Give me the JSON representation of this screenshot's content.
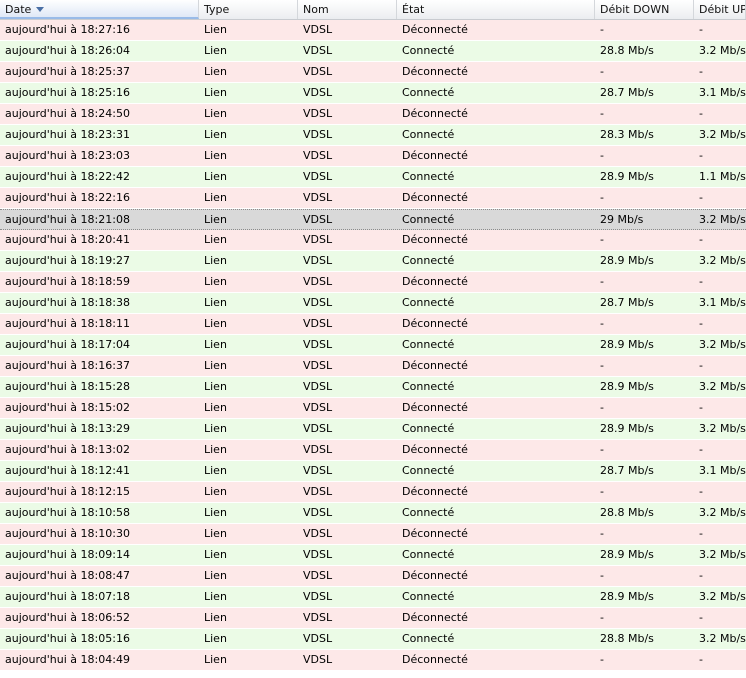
{
  "columns": {
    "date": "Date",
    "type": "Type",
    "nom": "Nom",
    "etat": "État",
    "debit_down": "Débit DOWN",
    "debit_up": "Débit UP"
  },
  "sort": {
    "column": "date",
    "direction": "descending"
  },
  "colors": {
    "disconnected_row": "#fde8e8",
    "connected_row": "#ebfbe6",
    "selected_row": "#d9d9d9",
    "header_sorted_accent": "#99bbe8"
  },
  "selected_index": 9,
  "rows": [
    {
      "date": "aujourd'hui à 18:27:16",
      "type": "Lien",
      "nom": "VDSL",
      "etat": "Déconnecté",
      "down": "-",
      "up": "-"
    },
    {
      "date": "aujourd'hui à 18:26:04",
      "type": "Lien",
      "nom": "VDSL",
      "etat": "Connecté",
      "down": "28.8 Mb/s",
      "up": "3.2 Mb/s"
    },
    {
      "date": "aujourd'hui à 18:25:37",
      "type": "Lien",
      "nom": "VDSL",
      "etat": "Déconnecté",
      "down": "-",
      "up": "-"
    },
    {
      "date": "aujourd'hui à 18:25:16",
      "type": "Lien",
      "nom": "VDSL",
      "etat": "Connecté",
      "down": "28.7 Mb/s",
      "up": "3.1 Mb/s"
    },
    {
      "date": "aujourd'hui à 18:24:50",
      "type": "Lien",
      "nom": "VDSL",
      "etat": "Déconnecté",
      "down": "-",
      "up": "-"
    },
    {
      "date": "aujourd'hui à 18:23:31",
      "type": "Lien",
      "nom": "VDSL",
      "etat": "Connecté",
      "down": "28.3 Mb/s",
      "up": "3.2 Mb/s"
    },
    {
      "date": "aujourd'hui à 18:23:03",
      "type": "Lien",
      "nom": "VDSL",
      "etat": "Déconnecté",
      "down": "-",
      "up": "-"
    },
    {
      "date": "aujourd'hui à 18:22:42",
      "type": "Lien",
      "nom": "VDSL",
      "etat": "Connecté",
      "down": "28.9 Mb/s",
      "up": "1.1 Mb/s"
    },
    {
      "date": "aujourd'hui à 18:22:16",
      "type": "Lien",
      "nom": "VDSL",
      "etat": "Déconnecté",
      "down": "-",
      "up": "-"
    },
    {
      "date": "aujourd'hui à 18:21:08",
      "type": "Lien",
      "nom": "VDSL",
      "etat": "Connecté",
      "down": "29 Mb/s",
      "up": "3.2 Mb/s"
    },
    {
      "date": "aujourd'hui à 18:20:41",
      "type": "Lien",
      "nom": "VDSL",
      "etat": "Déconnecté",
      "down": "-",
      "up": "-"
    },
    {
      "date": "aujourd'hui à 18:19:27",
      "type": "Lien",
      "nom": "VDSL",
      "etat": "Connecté",
      "down": "28.9 Mb/s",
      "up": "3.2 Mb/s"
    },
    {
      "date": "aujourd'hui à 18:18:59",
      "type": "Lien",
      "nom": "VDSL",
      "etat": "Déconnecté",
      "down": "-",
      "up": "-"
    },
    {
      "date": "aujourd'hui à 18:18:38",
      "type": "Lien",
      "nom": "VDSL",
      "etat": "Connecté",
      "down": "28.7 Mb/s",
      "up": "3.1 Mb/s"
    },
    {
      "date": "aujourd'hui à 18:18:11",
      "type": "Lien",
      "nom": "VDSL",
      "etat": "Déconnecté",
      "down": "-",
      "up": "-"
    },
    {
      "date": "aujourd'hui à 18:17:04",
      "type": "Lien",
      "nom": "VDSL",
      "etat": "Connecté",
      "down": "28.9 Mb/s",
      "up": "3.2 Mb/s"
    },
    {
      "date": "aujourd'hui à 18:16:37",
      "type": "Lien",
      "nom": "VDSL",
      "etat": "Déconnecté",
      "down": "-",
      "up": "-"
    },
    {
      "date": "aujourd'hui à 18:15:28",
      "type": "Lien",
      "nom": "VDSL",
      "etat": "Connecté",
      "down": "28.9 Mb/s",
      "up": "3.2 Mb/s"
    },
    {
      "date": "aujourd'hui à 18:15:02",
      "type": "Lien",
      "nom": "VDSL",
      "etat": "Déconnecté",
      "down": "-",
      "up": "-"
    },
    {
      "date": "aujourd'hui à 18:13:29",
      "type": "Lien",
      "nom": "VDSL",
      "etat": "Connecté",
      "down": "28.9 Mb/s",
      "up": "3.2 Mb/s"
    },
    {
      "date": "aujourd'hui à 18:13:02",
      "type": "Lien",
      "nom": "VDSL",
      "etat": "Déconnecté",
      "down": "-",
      "up": "-"
    },
    {
      "date": "aujourd'hui à 18:12:41",
      "type": "Lien",
      "nom": "VDSL",
      "etat": "Connecté",
      "down": "28.7 Mb/s",
      "up": "3.1 Mb/s"
    },
    {
      "date": "aujourd'hui à 18:12:15",
      "type": "Lien",
      "nom": "VDSL",
      "etat": "Déconnecté",
      "down": "-",
      "up": "-"
    },
    {
      "date": "aujourd'hui à 18:10:58",
      "type": "Lien",
      "nom": "VDSL",
      "etat": "Connecté",
      "down": "28.8 Mb/s",
      "up": "3.2 Mb/s"
    },
    {
      "date": "aujourd'hui à 18:10:30",
      "type": "Lien",
      "nom": "VDSL",
      "etat": "Déconnecté",
      "down": "-",
      "up": "-"
    },
    {
      "date": "aujourd'hui à 18:09:14",
      "type": "Lien",
      "nom": "VDSL",
      "etat": "Connecté",
      "down": "28.9 Mb/s",
      "up": "3.2 Mb/s"
    },
    {
      "date": "aujourd'hui à 18:08:47",
      "type": "Lien",
      "nom": "VDSL",
      "etat": "Déconnecté",
      "down": "-",
      "up": "-"
    },
    {
      "date": "aujourd'hui à 18:07:18",
      "type": "Lien",
      "nom": "VDSL",
      "etat": "Connecté",
      "down": "28.9 Mb/s",
      "up": "3.2 Mb/s"
    },
    {
      "date": "aujourd'hui à 18:06:52",
      "type": "Lien",
      "nom": "VDSL",
      "etat": "Déconnecté",
      "down": "-",
      "up": "-"
    },
    {
      "date": "aujourd'hui à 18:05:16",
      "type": "Lien",
      "nom": "VDSL",
      "etat": "Connecté",
      "down": "28.8 Mb/s",
      "up": "3.2 Mb/s"
    },
    {
      "date": "aujourd'hui à 18:04:49",
      "type": "Lien",
      "nom": "VDSL",
      "etat": "Déconnecté",
      "down": "-",
      "up": "-"
    }
  ]
}
